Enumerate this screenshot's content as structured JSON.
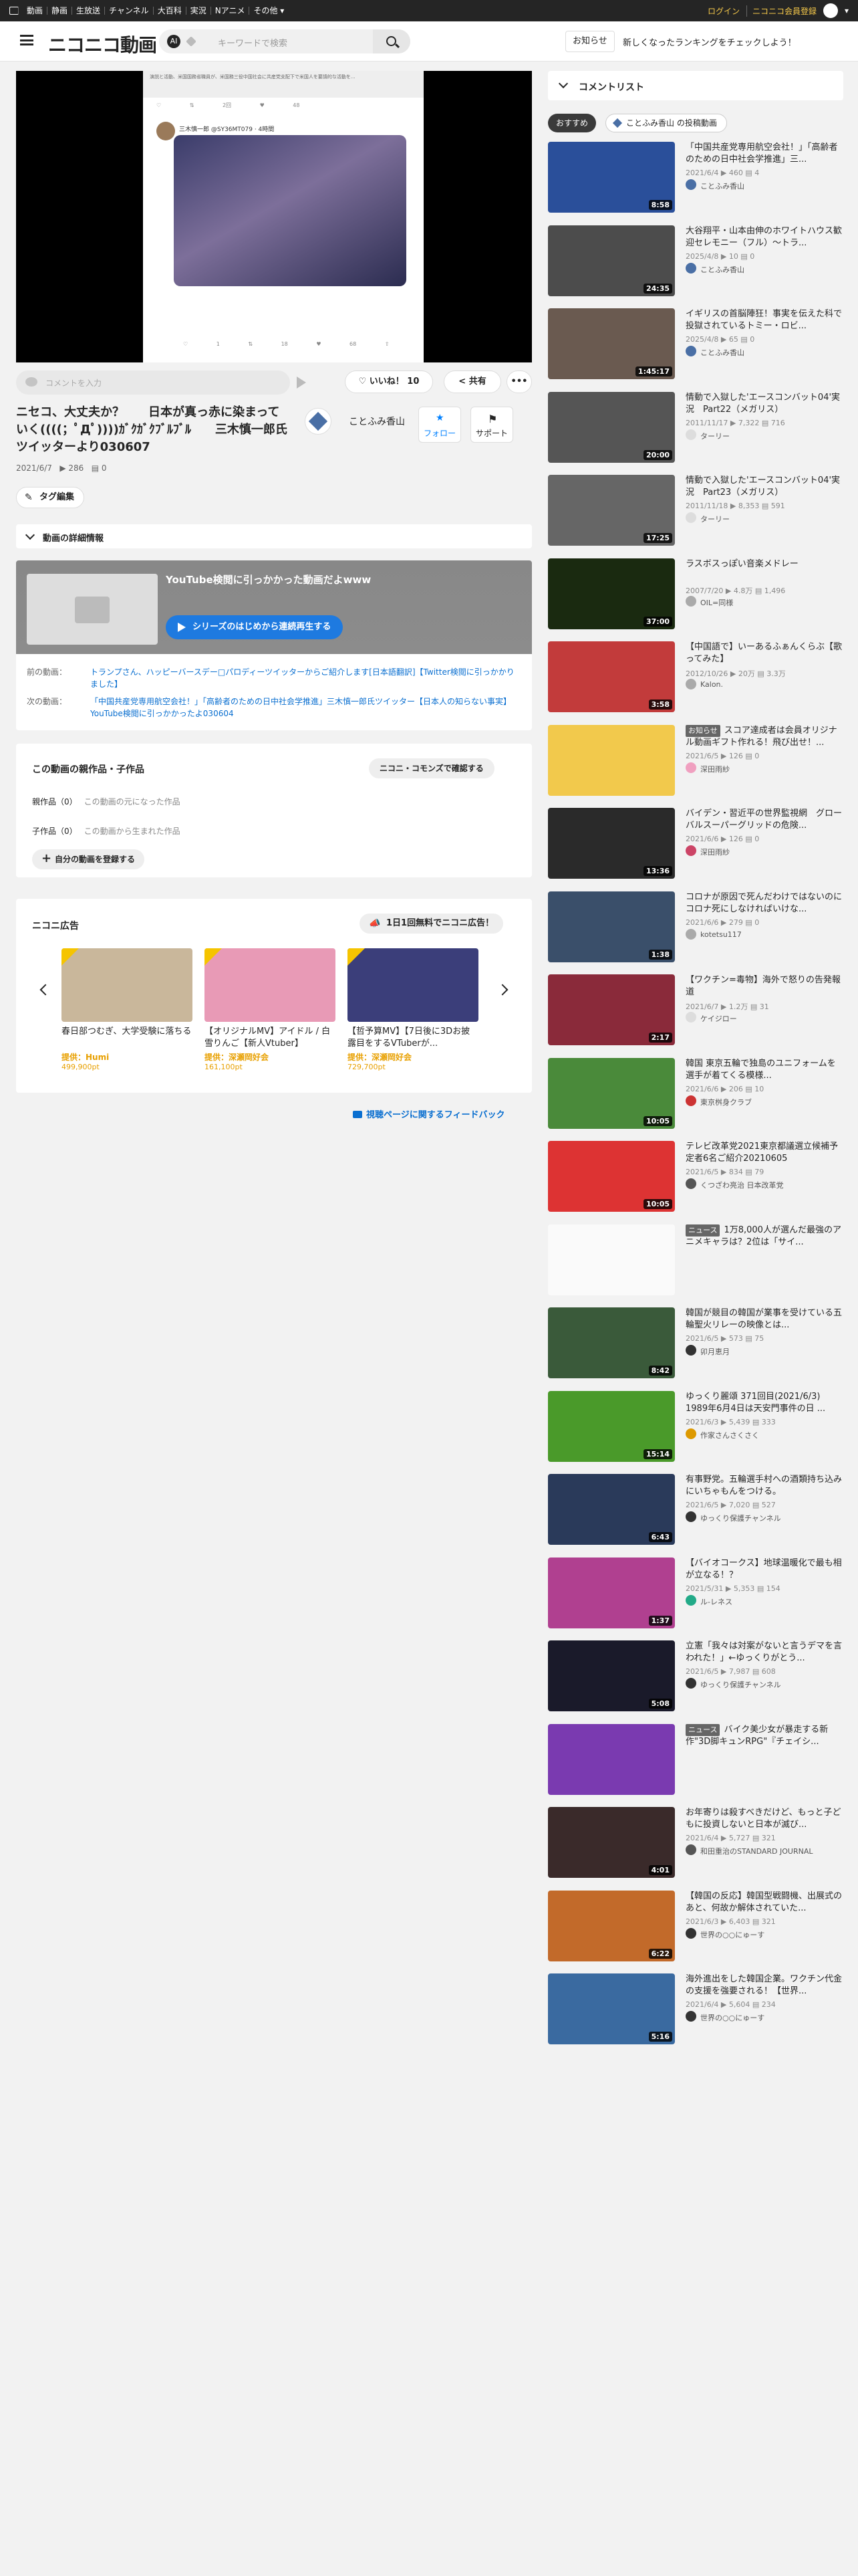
{
  "topbar": {
    "nav": [
      "動画",
      "静画",
      "生放送",
      "チャンネル",
      "大百科",
      "実況",
      "Nアニメ",
      "その他 ▾"
    ],
    "login": "ログイン",
    "premium": "ニコニコ会員登録"
  },
  "header": {
    "brand": "ニコニコ動画",
    "ai_label": "AI",
    "search_placeholder": "キーワードで検索",
    "notice_label": "お知らせ",
    "notice_text": "新しくなったランキングをチェックしよう！"
  },
  "player": {
    "tweet_header": "演説と活動、米国国務省職員が、米国務三役中国社会に共産党支配下で米国人を要請的な活動を...",
    "tweet_actions": "♡  ⇅ 2回  ♥ 48",
    "tweet_user": "三木慎一郎 @SY36MT079 · 4時間",
    "tweet_actions2": "♡ 1  ⇅ 18  ♥ 68  ⇧"
  },
  "comment_input": {
    "placeholder": "コメントを入力"
  },
  "actions": {
    "like": "いいね！ 10",
    "share": "共有",
    "more": "•••"
  },
  "video": {
    "title": "ニセコ、大丈夫か？　　日本が真っ赤に染まっていく((((；ﾟДﾟ))))ｶﾞｸｶﾞｸﾌﾞﾙﾌﾞﾙ　　三木慎一郎氏ツイッターより030607",
    "date": "2021/6/7",
    "views": "▶ 286",
    "comments": "▤ 0",
    "channel": "ことふみ香山",
    "follow": "フォロー",
    "support": "サポート",
    "tag_edit": "タグ編集",
    "details_label": "動画の詳細情報"
  },
  "series": {
    "title": "YouTube検閲に引っかかった動画だよwww",
    "play_label": "シリーズのはじめから連続再生する",
    "prev_label": "前の動画：",
    "prev_title": "トランプさん、ハッピーバースデー□パロディーツイッターからご紹介します[日本語翻訳]【Twitter検閲に引っかかりました】",
    "next_label": "次の動画：",
    "next_title": "「中国共産党専用航空会社！」「高齢者のための日中社会学推進」三木慎一郎氏ツイッター【日本人の知らない事実】YouTube検閲に引っかかったよ030604"
  },
  "parents": {
    "heading": "この動画の親作品・子作品",
    "commons_btn": "ニコニ・コモンズで確認する",
    "parent_label": "親作品（0）",
    "parent_empty": "この動画の元になった作品",
    "child_label": "子作品（0）",
    "child_empty": "この動画から生まれた作品",
    "register_btn": "自分の動画を登録する"
  },
  "ads": {
    "heading": "ニコニ広告",
    "free_btn": "1日1回無料でニコニ広告！",
    "cards": [
      {
        "title": "春日部つむぎ、大学受験に落ちる",
        "by": "提供：Humi",
        "pts": "499,900pt",
        "color": "#c9b79b"
      },
      {
        "title": "【オリジナルMV】アイドル / 白雪りんご【新人Vtuber】",
        "by": "提供：深瀬岡好会",
        "pts": "161,100pt",
        "color": "#e89ab6"
      },
      {
        "title": "【哲予算MV】【7日後に3Dお披露目をするVTuberが...",
        "by": "提供：深瀬岡好会",
        "pts": "729,700pt",
        "color": "#3b3e7a"
      }
    ]
  },
  "feedback": "視聴ページに関するフィードバック",
  "sidebar": {
    "heading": "コメントリスト",
    "tab_recommend": "おすすめ",
    "tab_channel": "ことふみ香山 の投稿動画",
    "items": [
      {
        "title": "「中国共産党専用航空会社！」「高齢者のための日中社会学推進」三...",
        "meta": "2021/6/4 ▶ 460 ▤ 4",
        "owner": "ことふみ香山",
        "dur": "8:58",
        "color": "#2a4f9a",
        "oc": "#4a6fa5"
      },
      {
        "title": "大谷翔平・山本由伸のホワイトハウス歓迎セレモニー（フル）～トラ...",
        "meta": "2025/4/8 ▶ 10 ▤ 0",
        "owner": "ことふみ香山",
        "dur": "24:35",
        "color": "#4c4c4c",
        "oc": "#4a6fa5"
      },
      {
        "title": "イギリスの首脳陣狂！事実を伝えた科で投獄されているトミー・ロビ...",
        "meta": "2025/4/8 ▶ 65 ▤ 0",
        "owner": "ことふみ香山",
        "dur": "1:45:17",
        "color": "#6a5a50",
        "oc": "#4a6fa5"
      },
      {
        "title": "情動で入獄した'エースコンバット04'実況　Part22（メガリス）",
        "meta": "2011/11/17 ▶ 7,322 ▤ 716",
        "owner": "ターリー",
        "dur": "20:00",
        "color": "#555",
        "oc": "#ddd"
      },
      {
        "title": "情動で入獄した'エースコンバット04'実況　Part23（メガリス）",
        "meta": "2011/11/18 ▶ 8,353 ▤ 591",
        "owner": "ターリー",
        "dur": "17:25",
        "color": "#666",
        "oc": "#ddd"
      },
      {
        "title": "ラスボスっぽい音楽メドレー",
        "meta": "2007/7/20 ▶ 4.8万 ▤ 1,496",
        "owner": "OIL=同様",
        "dur": "37:00",
        "color": "#1a2a10",
        "oc": "#aaa"
      },
      {
        "title": "【中国語で】いーあるふぁんくらぶ【歌ってみた】",
        "meta": "2012/10/26 ▶ 20万 ▤ 3.3万",
        "owner": "Kalon.",
        "dur": "3:58",
        "color": "#c23b3b",
        "oc": "#aaa"
      },
      {
        "title": "スコア達成者は会員オリジナル動画ギフト作れる！飛び出せ！...",
        "meta": "2021/6/5 ▶ 126 ▤ 0",
        "owner": "深田雨紗",
        "dur": "",
        "color": "#f2c94c",
        "oc": "#f0a0c0",
        "news": "お知らせ"
      },
      {
        "title": "バイデン・習近平の世界監視網　グローバルスーパーグリッドの危険...",
        "meta": "2021/6/6 ▶ 126 ▤ 0",
        "owner": "深田雨紗",
        "dur": "13:36",
        "color": "#2a2a2a",
        "oc": "#c46"
      },
      {
        "title": "コロナが原因で死んだわけではないのにコロナ死にしなければいけな...",
        "meta": "2021/6/6 ▶ 279 ▤ 0",
        "owner": "kotetsu117",
        "dur": "1:38",
        "color": "#3a4f6a",
        "oc": "#aaa"
      },
      {
        "title": "【ワクチン=毒物】海外で怒りの告発報道",
        "meta": "2021/6/7 ▶ 1.2万 ▤ 31",
        "owner": "ケイジロー",
        "dur": "2:17",
        "color": "#8a2a3a",
        "oc": "#ddd"
      },
      {
        "title": "韓国 東京五輪で独島のユニフォームを選手が着てくる模様...",
        "meta": "2021/6/6 ▶ 206 ▤ 10",
        "owner": "東京桝身クラブ",
        "dur": "10:05",
        "color": "#4a8a3a",
        "oc": "#c33"
      },
      {
        "title": "テレビ改革党2021東京都議選立候補予定者6名ご紹介20210605",
        "meta": "2021/6/5 ▶ 834 ▤ 79",
        "owner": "くつざわ亮治 日本改革党",
        "dur": "10:05",
        "color": "#d33",
        "oc": "#555"
      },
      {
        "title": "1万8,000人が選んだ最強のアニメキャラは？2位は「サイ...",
        "meta": "",
        "owner": "",
        "dur": "",
        "color": "#fafafa",
        "oc": "#ccc",
        "news": "ニュース"
      },
      {
        "title": "韓国が競目の韓国が業事を受けている五輪聖火リレーの映像とは...",
        "meta": "2021/6/5 ▶ 573 ▤ 75",
        "owner": "卯月恵月",
        "dur": "8:42",
        "color": "#3a5a3a",
        "oc": "#333"
      },
      {
        "title": "ゆっくり麗頌 371回目(2021/6/3) 1989年6月4日は天安門事件の日 ...",
        "meta": "2021/6/3 ▶ 5,439 ▤ 333",
        "owner": "作家さんさくさく",
        "dur": "15:14",
        "color": "#4a9a2a",
        "oc": "#d90"
      },
      {
        "title": "有事野党。五輪選手村への酒類持ち込みにいちゃもんをつける。",
        "meta": "2021/6/5 ▶ 7,020 ▤ 527",
        "owner": "ゆっくり保護チャンネル",
        "dur": "6:43",
        "color": "#2a3a5a",
        "oc": "#333"
      },
      {
        "title": "【バイオコークス】地球温暖化で最も相が立なる！？",
        "meta": "2021/5/31 ▶ 5,353 ▤ 154",
        "owner": "ル-レネス",
        "dur": "1:37",
        "color": "#b04090",
        "oc": "#2a8"
      },
      {
        "title": "立憲「我々は対案がないと言うデマを言われた！」←ゆっくりがとう...",
        "meta": "2021/6/5 ▶ 7,987 ▤ 608",
        "owner": "ゆっくり保護チャンネル",
        "dur": "5:08",
        "color": "#1a1a2a",
        "oc": "#333"
      },
      {
        "title": "バイク美少女が暴走する新作\"3D脚キュンRPG\"『チェイシ...",
        "meta": "",
        "owner": "",
        "dur": "",
        "color": "#7a3ab0",
        "oc": "#ccc",
        "news": "ニュース"
      },
      {
        "title": "お年寄りは殺すべきだけど、もっと子どもに投資しないと日本が滅び...",
        "meta": "2021/6/4 ▶ 5,727 ▤ 321",
        "owner": "和田重治のSTANDARD JOURNAL",
        "dur": "4:01",
        "color": "#3a2a2a",
        "oc": "#555"
      },
      {
        "title": "【韓国の反応】韓国型戦闘機、出展式のあと、何故か解体されていた...",
        "meta": "2021/6/3 ▶ 6,403 ▤ 321",
        "owner": "世界の○○にゅーす",
        "dur": "6:22",
        "color": "#c26a2a",
        "oc": "#333"
      },
      {
        "title": "海外進出をした韓国企業。ワクチン代金の支援を強要される！【世界...",
        "meta": "2021/6/4 ▶ 5,604 ▤ 234",
        "owner": "世界の○○にゅーす",
        "dur": "5:16",
        "color": "#3a6aa0",
        "oc": "#333"
      }
    ]
  }
}
